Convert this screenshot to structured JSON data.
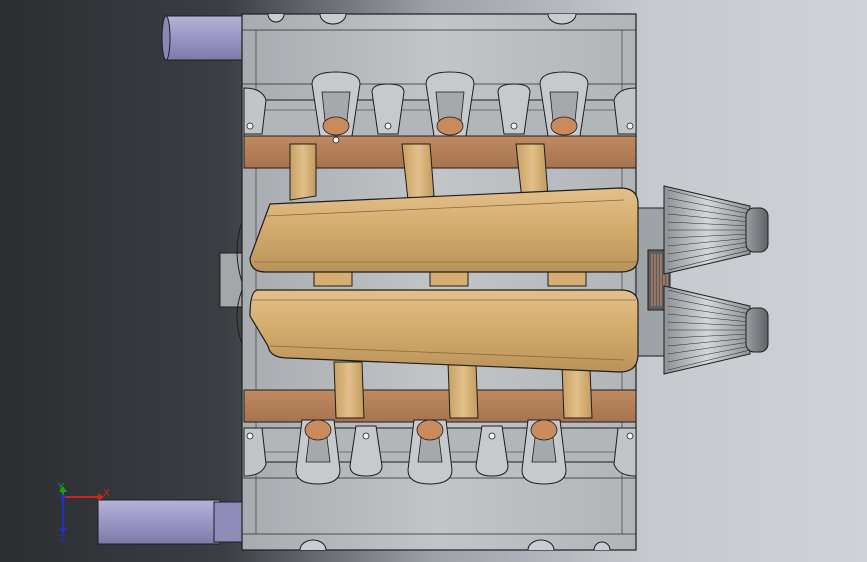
{
  "viewport": {
    "background_left": "#2d3034",
    "background_right": "#c9ccd1",
    "body_fill": "#b9bcbf",
    "manifold_color": "#d6ae72",
    "copper_color": "#b07c54",
    "pipe_color": "#9c98c6"
  },
  "triad": {
    "x_label": "X",
    "y_label": "Y",
    "z_label": "Z"
  }
}
